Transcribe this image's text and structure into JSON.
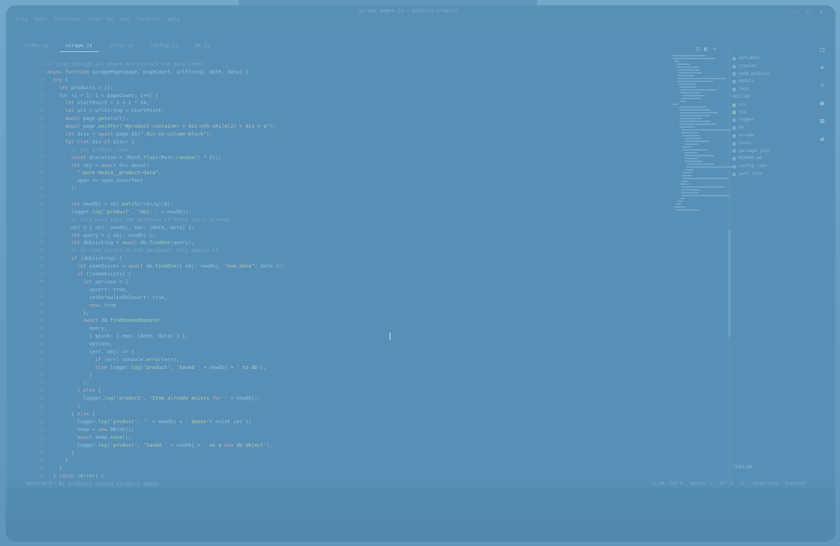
{
  "menu": [
    "File",
    "Edit",
    "Selection",
    "View",
    "Go",
    "Run",
    "Terminal",
    "Help"
  ],
  "window_title": "scrape_pages.js — project-crawler",
  "tabs": [
    {
      "label": "index.js",
      "active": false
    },
    {
      "label": "scrape.js",
      "active": true
    },
    {
      "label": "utils.js",
      "active": false
    },
    {
      "label": "config.js",
      "active": false
    },
    {
      "label": "db.js",
      "active": false
    }
  ],
  "code_lines": [
    {
      "n": "12",
      "t": "// loop through all pages and extract the data items"
    },
    {
      "n": "13",
      "t": "async function scrapePage(page, pageCount, urlString, date, data) {"
    },
    {
      "n": "14",
      "t": "  try {"
    },
    {
      "n": "15",
      "t": "    let products = [];"
    },
    {
      "n": "16",
      "t": "    for (i = 1; i < pageCount; i++) {"
    },
    {
      "n": "17",
      "t": "      let startPoint = 1 + i * 24;"
    },
    {
      "n": "18",
      "t": "      let url = urlString + startPoint;"
    },
    {
      "n": "19",
      "t": "      await page.goto(url);"
    },
    {
      "n": "20",
      "t": "      await page.waitFor(\"#product-container > div:nth-child(2) > div > a\");"
    },
    {
      "n": "21",
      "t": "      let divs = await page.$$(\".div-in-column-block\");"
    },
    {
      "n": "22",
      "t": "      for (let div of divs) {"
    },
    {
      "n": "23",
      "t": "        // get product code"
    },
    {
      "n": "24",
      "t": "        const dlocation = (Math.floor(Math.random() * 2));"
    },
    {
      "n": "25",
      "t": "        let obj = await div.$eval("
    },
    {
      "n": "26",
      "t": "          \".pure-media__product-data\","
    },
    {
      "n": "27",
      "t": "          span => span.innerText"
    },
    {
      "n": "28",
      "t": "        );"
    },
    {
      "n": "29",
      "t": ""
    },
    {
      "n": "30",
      "t": "        let newObj = obj.match(/\\d+/g)[0];"
    },
    {
      "n": "31",
      "t": "        logger.log('product', 'obj: ' + newObj);"
    },
    {
      "n": "32",
      "t": "        // only push into the database if there isn't already"
    },
    {
      "n": "33",
      "t": "        obj = { obj: newObj, ean: [date, data] };"
    },
    {
      "n": "34",
      "t": "        let query = { obj: newObj };"
    },
    {
      "n": "35",
      "t": "        let dbExisting = await db.findOne(query);"
    },
    {
      "n": "36",
      "t": "        // if item exists in the database, only update it"
    },
    {
      "n": "37",
      "t": "        if (dbExisting) {"
    },
    {
      "n": "38",
      "t": "          let someExists = await db.findOne({ obj: newObj, \"ean.date\": date });"
    },
    {
      "n": "39",
      "t": "          if (!someExists) {"
    },
    {
      "n": "40",
      "t": "            let options = {"
    },
    {
      "n": "41",
      "t": "              upsert: true,"
    },
    {
      "n": "42",
      "t": "              setDefaultsOnInsert: true,"
    },
    {
      "n": "43",
      "t": "              new: true"
    },
    {
      "n": "44",
      "t": "            };"
    },
    {
      "n": "45",
      "t": "            await db.findOneAndUpdate("
    },
    {
      "n": "46",
      "t": "              query,"
    },
    {
      "n": "47",
      "t": "              { $push: { ean: [date, data] } },"
    },
    {
      "n": "48",
      "t": "              options,"
    },
    {
      "n": "49",
      "t": "              (err, obj) => {"
    },
    {
      "n": "50",
      "t": "                if (err) console.error(err);"
    },
    {
      "n": "51",
      "t": "                else logger.log('product', 'Saved ' + newObj + ' to db');"
    },
    {
      "n": "52",
      "t": "              }"
    },
    {
      "n": "53",
      "t": "            );"
    },
    {
      "n": "54",
      "t": "          } else {"
    },
    {
      "n": "55",
      "t": "            logger.log('product', 'Item already exists for ' + newObj);"
    },
    {
      "n": "56",
      "t": "          }"
    },
    {
      "n": "57",
      "t": "        } else {"
    },
    {
      "n": "58",
      "t": "          logger.log('product', '' + newObj + ' doesn't exist yet');"
    },
    {
      "n": "59",
      "t": "          temp = new DB(obj);"
    },
    {
      "n": "60",
      "t": "          await temp.save();"
    },
    {
      "n": "61",
      "t": "          logger.log('product', 'Saved ' + newObj + ' as a new db object');"
    },
    {
      "n": "62",
      "t": "        }"
    },
    {
      "n": "63",
      "t": "      }"
    },
    {
      "n": "64",
      "t": "    }"
    },
    {
      "n": "65",
      "t": "  } catch (error) {"
    },
    {
      "n": "66",
      "t": "    // products stored scrapers again"
    }
  ],
  "explorer": [
    {
      "label": "EXPLORER",
      "icon": "folder",
      "green": false
    },
    {
      "label": "crawler",
      "icon": "folder",
      "green": false
    },
    {
      "label": "node_modules",
      "icon": "folder",
      "green": false
    },
    {
      "label": "models",
      "icon": "folder",
      "green": false
    },
    {
      "label": "logs",
      "icon": "folder",
      "green": false
    },
    {
      "label": "",
      "icon": "",
      "green": false
    },
    {
      "label": "OUTLINE",
      "icon": "",
      "green": false
    },
    {
      "label": "src",
      "icon": "file",
      "green": true
    },
    {
      "label": "lib",
      "icon": "file",
      "green": true
    },
    {
      "label": "logger",
      "icon": "file",
      "green": false
    },
    {
      "label": "db",
      "icon": "file",
      "green": false
    },
    {
      "label": "scrape",
      "icon": "file",
      "green": false
    },
    {
      "label": "index",
      "icon": "file",
      "green": false
    },
    {
      "label": "package.json",
      "icon": "file",
      "green": false
    },
    {
      "label": "README.md",
      "icon": "file",
      "green": false
    },
    {
      "label": "config.json",
      "icon": "file",
      "green": false
    },
    {
      "label": "yarn.lock",
      "icon": "file",
      "green": false
    }
  ],
  "outline_label": "TIMELINE",
  "status": {
    "left": "master  ⊗ 0  ⚠ 0",
    "right": [
      "Ln 36, Col 9",
      "Spaces: 2",
      "UTF-8",
      "LF",
      "JavaScript",
      "Prettier"
    ]
  },
  "colors": {
    "background": "#6aa2c6",
    "screen": "#4e87af",
    "accent": "#c9e3f0"
  }
}
